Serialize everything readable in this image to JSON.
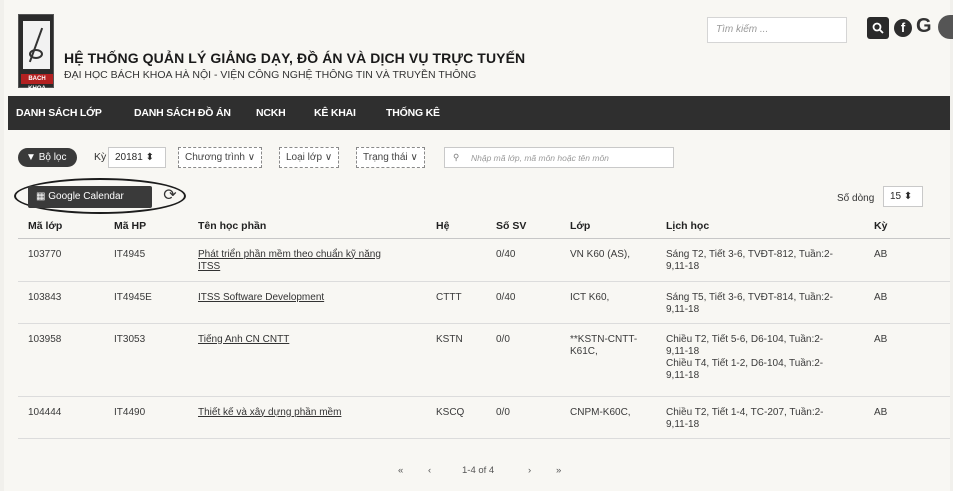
{
  "header": {
    "logo_text": "BACH KHOA",
    "title": "HỆ THỐNG QUẢN LÝ GIẢNG DẠY, ĐỒ ÁN VÀ DỊCH VỤ TRỰC TUYẾN",
    "subtitle": "ĐẠI HỌC BÁCH KHOA HÀ NỘI - VIỆN CÔNG NGHỆ THÔNG TIN VÀ TRUYỀN THÔNG",
    "search_placeholder": "Tìm kiếm ...",
    "search_icon": "search-icon",
    "facebook_icon": "f",
    "google_icon": "G"
  },
  "nav": {
    "items": [
      "DANH SÁCH LỚP",
      "DANH SÁCH ĐỒ ÁN",
      "NCKH",
      "KÊ KHAI",
      "THỐNG KÊ"
    ]
  },
  "toolbar": {
    "filter_label": "Bộ lọc",
    "ky_label": "Kỳ",
    "ky_value": "20181",
    "dropdowns": [
      "Chương trình",
      "Loại lớp",
      "Trạng thái"
    ],
    "search_placeholder": "Nhập mã lớp, mã môn hoặc tên môn"
  },
  "actions": {
    "gcal_label": "Google Calendar",
    "rows_label": "Số dòng",
    "rows_value": "15"
  },
  "table": {
    "headers": [
      "Mã lớp",
      "Mã HP",
      "Tên học phần",
      "Hệ",
      "Số SV",
      "Lớp",
      "Lịch học",
      "Kỳ"
    ],
    "rows": [
      {
        "ma_lop": "103770",
        "ma_hp": "IT4945",
        "ten_hp_1": "Phát triển phần mềm theo chuẩn kỹ năng",
        "ten_hp_2": "ITSS",
        "he": "",
        "so_sv": "0/40",
        "lop_1": "VN K60 (AS),",
        "lop_2": "",
        "lich_1": "Sáng T2, Tiết 3-6, TVĐT-812, Tuần:2-",
        "lich_2": "9,11-18",
        "lich_3": "",
        "lich_4": "",
        "ky": "AB"
      },
      {
        "ma_lop": "103843",
        "ma_hp": "IT4945E",
        "ten_hp_1": "ITSS Software Development",
        "ten_hp_2": "",
        "he": "CTTT",
        "so_sv": "0/40",
        "lop_1": "ICT K60,",
        "lop_2": "",
        "lich_1": "Sáng T5, Tiết 3-6, TVĐT-814, Tuần:2-",
        "lich_2": "9,11-18",
        "lich_3": "",
        "lich_4": "",
        "ky": "AB"
      },
      {
        "ma_lop": "103958",
        "ma_hp": "IT3053",
        "ten_hp_1": "Tiếng Anh CN CNTT",
        "ten_hp_2": "",
        "he": "KSTN",
        "so_sv": "0/0",
        "lop_1": "**KSTN-CNTT-",
        "lop_2": "K61C,",
        "lich_1": "Chiều T2, Tiết 5-6, D6-104, Tuần:2-",
        "lich_2": "9,11-18",
        "lich_3": "Chiều T4, Tiết 1-2, D6-104, Tuần:2-",
        "lich_4": "9,11-18",
        "ky": "AB"
      },
      {
        "ma_lop": "104444",
        "ma_hp": "IT4490",
        "ten_hp_1": "Thiết kế và xây dựng phần mềm",
        "ten_hp_2": "",
        "he": "KSCQ",
        "so_sv": "0/0",
        "lop_1": "CNPM-K60C,",
        "lop_2": "",
        "lich_1": "Chiều T2, Tiết 1-4, TC-207, Tuần:2-",
        "lich_2": "9,11-18",
        "lich_3": "",
        "lich_4": "",
        "ky": "AB"
      }
    ]
  },
  "pager": {
    "first": "«",
    "prev": "‹",
    "info": "1-4 of 4",
    "next": "›",
    "last": "»"
  }
}
